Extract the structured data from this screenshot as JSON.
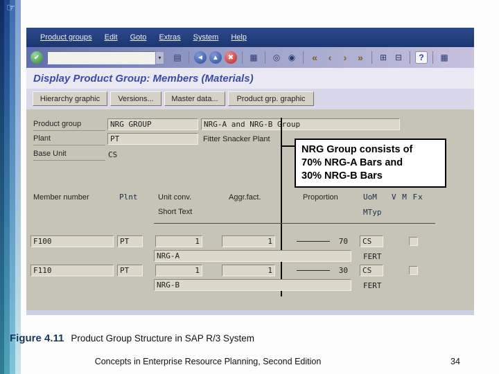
{
  "slide": {
    "pointer_glyph": "☞",
    "figure_label": "Figure 4.11",
    "figure_caption": "Product Group Structure in SAP R/3 System",
    "footer": "Concepts in Enterprise Resource Planning, Second Edition",
    "page_number": "34"
  },
  "sap": {
    "menu_items": [
      "Product groups",
      "Edit",
      "Goto",
      "Extras",
      "System",
      "Help"
    ],
    "toolbar": {
      "enter_glyph": "✔",
      "command_value": "",
      "command_dropdown_glyph": "▾",
      "icons": [
        {
          "type": "icon",
          "name": "save-icon",
          "glyph": "▤",
          "cls": "flat"
        },
        {
          "type": "separator"
        },
        {
          "type": "icon",
          "name": "back-icon",
          "glyph": "◄",
          "cls": "round blue"
        },
        {
          "type": "icon",
          "name": "exit-icon",
          "glyph": "▲",
          "cls": "round blue"
        },
        {
          "type": "icon",
          "name": "cancel-icon",
          "glyph": "✖",
          "cls": "round red"
        },
        {
          "type": "separator"
        },
        {
          "type": "icon",
          "name": "print-icon",
          "glyph": "▦",
          "cls": "flat"
        },
        {
          "type": "separator"
        },
        {
          "type": "icon",
          "name": "find-icon",
          "glyph": "◎",
          "cls": "flat"
        },
        {
          "type": "icon",
          "name": "find-next-icon",
          "glyph": "◉",
          "cls": "flat"
        },
        {
          "type": "separator"
        },
        {
          "type": "icon",
          "name": "first-page-icon",
          "glyph": "«",
          "cls": "flat pages"
        },
        {
          "type": "icon",
          "name": "previous-page-icon",
          "glyph": "‹",
          "cls": "flat pages"
        },
        {
          "type": "icon",
          "name": "next-page-icon",
          "glyph": "›",
          "cls": "flat pages"
        },
        {
          "type": "icon",
          "name": "last-page-icon",
          "glyph": "»",
          "cls": "flat pages"
        },
        {
          "type": "separator"
        },
        {
          "type": "icon",
          "name": "new-session-icon",
          "glyph": "⊞",
          "cls": "flat"
        },
        {
          "type": "icon",
          "name": "create-shortcut-icon",
          "glyph": "⊟",
          "cls": "flat"
        },
        {
          "type": "separator"
        },
        {
          "type": "icon",
          "name": "help-icon",
          "glyph": "?",
          "cls": "flat help"
        },
        {
          "type": "separator"
        },
        {
          "type": "icon",
          "name": "layout-menu-icon",
          "glyph": "▦",
          "cls": "flat"
        }
      ]
    },
    "title": "Display Product Group: Members (Materials)",
    "app_buttons": [
      "Hierarchy graphic",
      "Versions...",
      "Master data...",
      "Product grp. graphic"
    ],
    "form": {
      "product_group": {
        "label": "Product group",
        "value": "NRG GROUP",
        "desc": "NRG-A and NRG-B Group"
      },
      "plant": {
        "label": "Plant",
        "value": "PT",
        "desc": "Fitter Snacker Plant"
      },
      "base_unit": {
        "label": "Base Unit",
        "value": "CS"
      },
      "callout_text": "NRG Group consists of\n70% NRG-A Bars and\n30% NRG-B Bars"
    },
    "table": {
      "headers": {
        "member": "Member number",
        "plnt": "Plnt",
        "unit_conv": "Unit conv.",
        "aggr_fact": "Aggr.fact.",
        "proportion": "Proportion",
        "uom": "UoM",
        "vmfx": "V M Fx",
        "short_text": "Short Text",
        "mtyp": "MTyp"
      },
      "rows": [
        {
          "member": "F100",
          "plnt": "PT",
          "unit_conv": "1",
          "aggr_fact": "1",
          "proportion": "70",
          "uom": "CS",
          "short_text": "NRG-A",
          "mtyp": "FERT"
        },
        {
          "member": "F110",
          "plnt": "PT",
          "unit_conv": "1",
          "aggr_fact": "1",
          "proportion": "30",
          "uom": "CS",
          "short_text": "NRG-B",
          "mtyp": "FERT"
        }
      ]
    }
  }
}
